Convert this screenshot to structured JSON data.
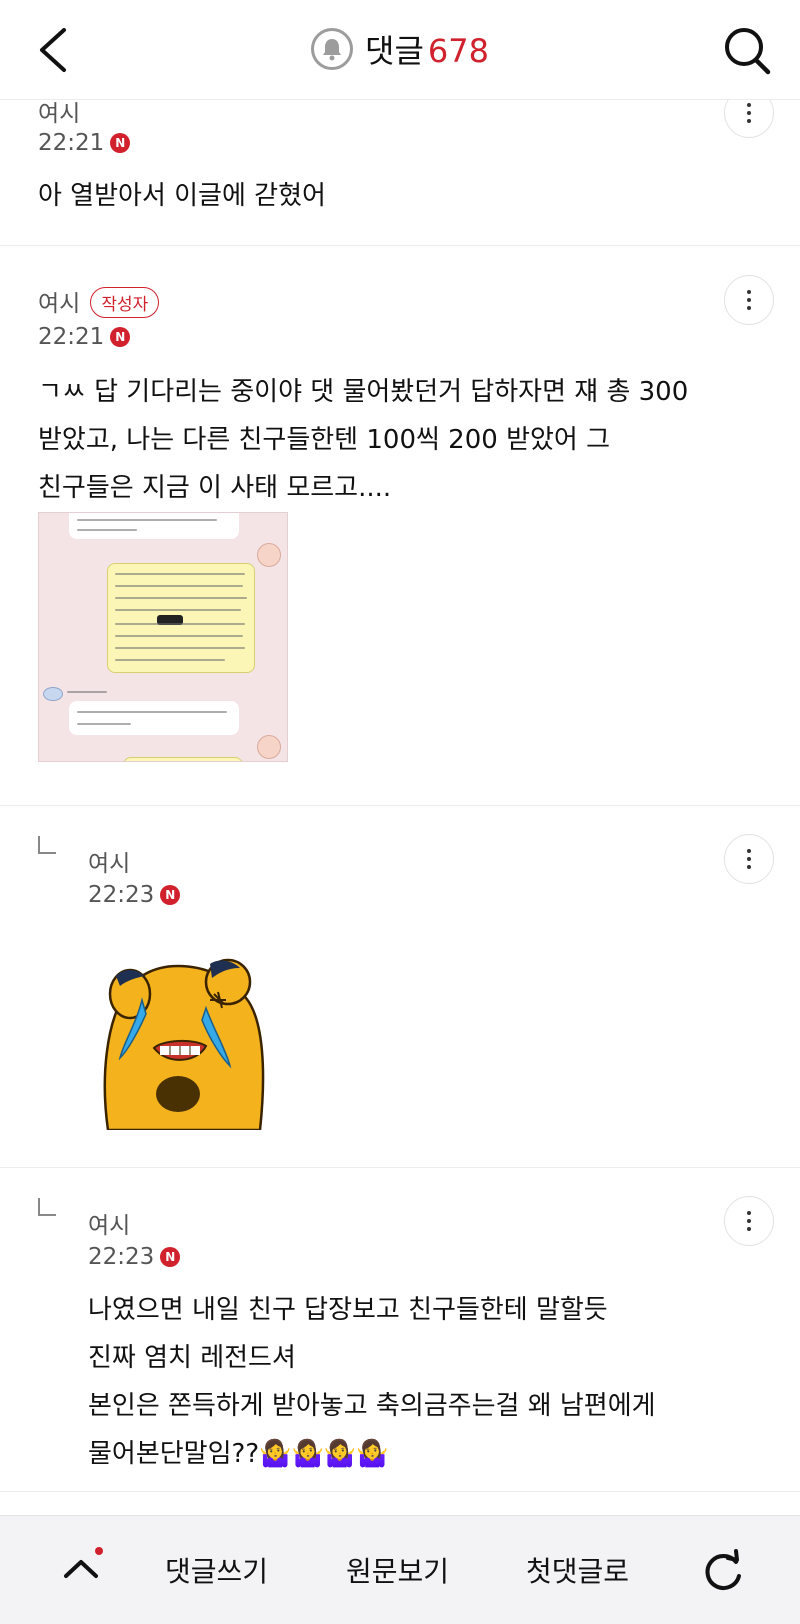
{
  "header": {
    "title": "댓글",
    "count": "678",
    "icons": {
      "back": "chevron-left-icon",
      "bell": "bell-icon",
      "search": "search-icon"
    }
  },
  "comments": [
    {
      "author": "여시",
      "time": "22:21",
      "badge": "N",
      "text": "아 열받아서 이글에 갇혔어"
    },
    {
      "author": "여시",
      "author_tag": "작성자",
      "time": "22:21",
      "badge": "N",
      "text": "ㄱㅆ 답 기다리는 중이야 댓 물어봤던거 답하자면 쟤 총 300\n받았고, 나는 다른 친구들한텐 100씩 200 받았어 그\n친구들은 지금 이 사태 모르고....",
      "image": "chat-screenshot"
    },
    {
      "author": "여시",
      "time": "22:23",
      "badge": "N",
      "is_reply": true,
      "image": "crying-character-sticker"
    },
    {
      "author": "여시",
      "time": "22:23",
      "badge": "N",
      "is_reply": true,
      "text": "나였으면 내일 친구 답장보고 친구들한테 말할듯\n진짜 염치 레전드셔\n본인은 쫀득하게 받아놓고 축의금주는걸 왜 남편에게\n물어본단말임??🤷‍♀️🤷‍♀️🤷‍♀️🤷‍♀️"
    }
  ],
  "bottom_bar": {
    "write": "댓글쓰기",
    "original": "원문보기",
    "first_comment": "첫댓글로",
    "icons": {
      "up": "chevron-up-icon",
      "refresh": "refresh-icon"
    }
  },
  "colors": {
    "accent": "#d0212c",
    "divider": "#ececec",
    "bottom_bg": "#f3f3f5"
  }
}
